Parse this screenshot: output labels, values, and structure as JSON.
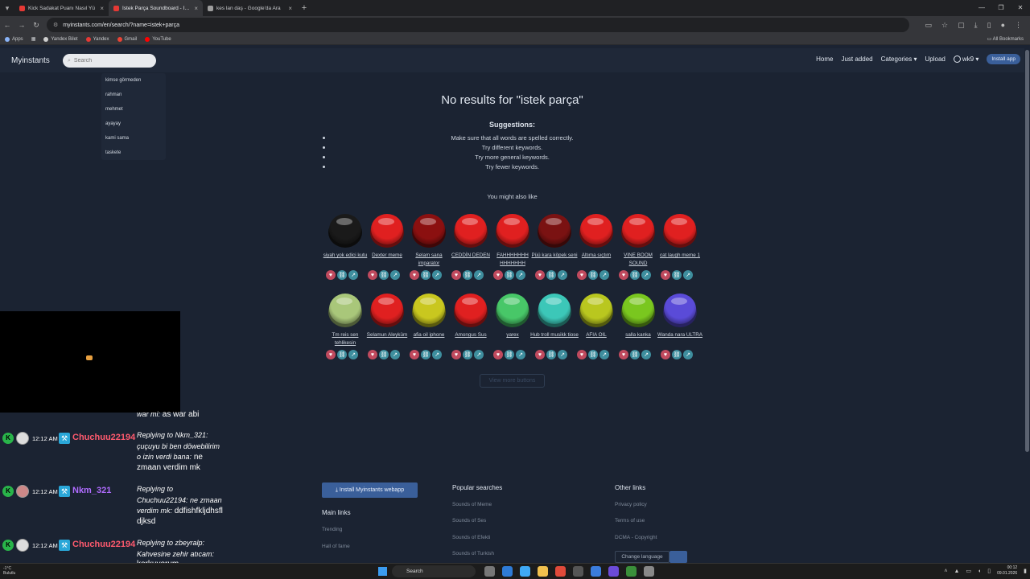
{
  "browser": {
    "tabs": [
      {
        "title": "Kick Sadakat Puanı Nasıl Yü",
        "color": "#e53935"
      },
      {
        "title": "İstek Parça Soundboard - İnstan",
        "color": "#e53935"
      },
      {
        "title": "kes lan daş - Google'da Ara",
        "color": "#9e9e9e"
      }
    ],
    "new_tab": "+",
    "url": "myinstants.com/en/search/?name=istek+parça",
    "bookmarks": [
      {
        "label": "Apps",
        "color": "#8ab4f8"
      },
      {
        "label": "Yandex Bilet",
        "color": "#cfcfcf"
      },
      {
        "label": "Yandex",
        "color": "#e53935"
      },
      {
        "label": "Gmail",
        "color": "#ea4335"
      },
      {
        "label": "YouTube",
        "color": "#ff0000"
      }
    ],
    "all_bookmarks": "All Bookmarks"
  },
  "site": {
    "brand": "Myinstants",
    "search_placeholder": "Search",
    "nav": {
      "home": "Home",
      "just_added": "Just added",
      "categories": "Categories ▾",
      "upload": "Upload",
      "user": "wk9 ▾",
      "install": "Install app"
    },
    "suggestions_dropdown": [
      "kimse görmeden",
      "rahman",
      "mehmet",
      "ayayay",
      "kami sama",
      "taskete"
    ]
  },
  "main": {
    "title": "No results for \"istek parça\"",
    "suggestions_title": "Suggestions:",
    "suggestions": [
      "Make sure that all words are spelled correctly.",
      "Try different keywords.",
      "Try more general keywords.",
      "Try fewer keywords."
    ],
    "also_like": "You might also like",
    "view_more": "View more buttons",
    "buttons": [
      {
        "label": "siyah yok edici kutu",
        "color": "#1a1a1a"
      },
      {
        "label": "Dexter meme",
        "color": "#e02020"
      },
      {
        "label": "Selam sana imparator",
        "color": "#8b1010"
      },
      {
        "label": "CEDDİN DEDEN",
        "color": "#e02020"
      },
      {
        "label": "FAHHHHHHH HHHHHHH",
        "color": "#e02020"
      },
      {
        "label": "Püü kara köpek seni",
        "color": "#7a1212"
      },
      {
        "label": "Altıma sıçtım",
        "color": "#e02020"
      },
      {
        "label": "VINE BOOM SOUND",
        "color": "#e02020"
      },
      {
        "label": "cat laugh meme 1",
        "color": "#e02020"
      },
      {
        "label": "Tm reis sen tehlikesin",
        "color": "#a9c77a"
      },
      {
        "label": "Selamun Aleyküm",
        "color": "#e02020"
      },
      {
        "label": "afia oil iphone",
        "color": "#c9c71f"
      },
      {
        "label": "Amongus Sus",
        "color": "#e02020"
      },
      {
        "label": "yarex",
        "color": "#48c768"
      },
      {
        "label": "Hub troll musikk tiose",
        "color": "#3cc7b8"
      },
      {
        "label": "AFIA OIL",
        "color": "#b9c71f"
      },
      {
        "label": "salla kanka",
        "color": "#7ac71f"
      },
      {
        "label": "Wanda nara ULTRA",
        "color": "#5a4bd8"
      }
    ]
  },
  "footer": {
    "install": "⤓ Install Myinstants webapp",
    "main_links_title": "Main links",
    "main_links": [
      "Trending",
      "Hall of fame"
    ],
    "popular_title": "Popular searches",
    "popular": [
      "Sounds of Meme",
      "Sounds of Ses",
      "Sounds of Efekti",
      "Sounds of Turkish"
    ],
    "other_title": "Other links",
    "other": [
      "Privacy policy",
      "Terms of use",
      "DCMA - Copyright"
    ],
    "change_language": "Change language"
  },
  "chat": [
    {
      "time": "12:12 AM",
      "user": "Chuchuu22194",
      "color": "#ff5a6e",
      "reply": "Replying to Nkm_321: çuçuyu bi ben döwebilirim o izin verdi bana:",
      "text": "ne zmaan verdim mk"
    },
    {
      "time": "12:12 AM",
      "user": "Nkm_321",
      "color": "#b06cff",
      "reply": "Replying to Chuchuu22194: ne zmaan verdim mk:",
      "text": "ddfishfkljdhsfldjksd"
    },
    {
      "time": "12:12 AM",
      "user": "Chuchuu22194",
      "color": "#ff5a6e",
      "reply": "Replying to zbeyralp: Kahvesine zehir atıcam:",
      "text": "korkuyorum"
    }
  ],
  "chat_top": {
    "reply": "war mi:",
    "text": "as war abi"
  },
  "taskbar": {
    "weather_temp": "-1°C",
    "weather_desc": "Bulutlu",
    "search": "Search",
    "time": "00:12",
    "date": "09.01.2026"
  }
}
